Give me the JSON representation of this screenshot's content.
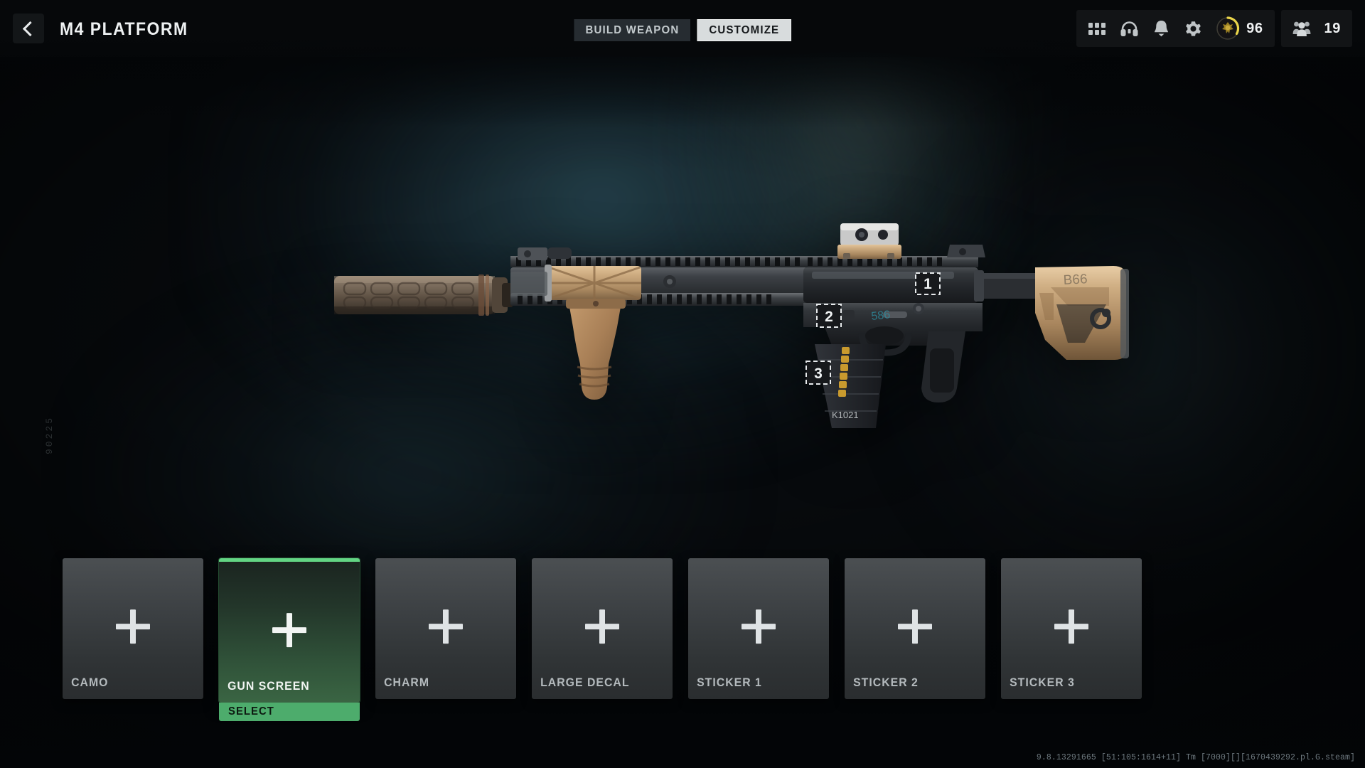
{
  "header": {
    "back_icon": "chevron-left-icon",
    "title": "M4 PLATFORM",
    "tabs": [
      {
        "label": "BUILD WEAPON",
        "active": false
      },
      {
        "label": "CUSTOMIZE",
        "active": true
      }
    ],
    "icons": [
      {
        "name": "grid-menu-icon",
        "label": ""
      },
      {
        "name": "headphones-icon",
        "label": ""
      },
      {
        "name": "bell-icon",
        "label": ""
      },
      {
        "name": "gear-icon",
        "label": ""
      }
    ],
    "level": {
      "icon": "rank-emblem-icon",
      "value": "96",
      "arc_color": "#e9d44a"
    },
    "party": {
      "icon": "party-members-icon",
      "value": "19"
    }
  },
  "stage": {
    "side_code": "90225",
    "weapon_name": "M4 PLATFORM",
    "sticker_slots": [
      "1",
      "2",
      "3"
    ],
    "magazine_code": "K1021",
    "stock_marking": "B66",
    "receiver_marking": "586"
  },
  "customize_slots": [
    {
      "label": "CAMO",
      "icon": "plus-icon",
      "selected": false,
      "action": ""
    },
    {
      "label": "GUN SCREEN",
      "icon": "plus-icon",
      "selected": true,
      "action": "SELECT"
    },
    {
      "label": "CHARM",
      "icon": "plus-icon",
      "selected": false,
      "action": ""
    },
    {
      "label": "LARGE DECAL",
      "icon": "plus-icon",
      "selected": false,
      "action": ""
    },
    {
      "label": "STICKER 1",
      "icon": "plus-icon",
      "selected": false,
      "action": ""
    },
    {
      "label": "STICKER 2",
      "icon": "plus-icon",
      "selected": false,
      "action": ""
    },
    {
      "label": "STICKER 3",
      "icon": "plus-icon",
      "selected": false,
      "action": ""
    }
  ],
  "footer": {
    "build_stamp": "9.8.13291665 [51:105:1614+11] Tm [7000][][1670439292.pl.G.steam]"
  },
  "colors": {
    "accent_green": "#4dac6c",
    "accent_green_border": "#63d584",
    "tab_active_bg": "#d8dcdd",
    "tab_inactive_bg": "#262c31",
    "panel_bg": "#3d4144",
    "text_primary": "#eef1f2",
    "text_muted": "#b4babd",
    "level_gold": "#e9d44a"
  }
}
